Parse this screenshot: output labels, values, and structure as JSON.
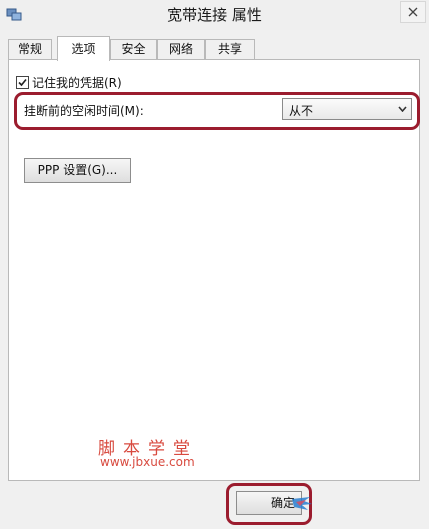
{
  "window": {
    "title": "宽带连接 属性"
  },
  "tabs": [
    {
      "label": "常规",
      "active": false
    },
    {
      "label": "选项",
      "active": true
    },
    {
      "label": "安全",
      "active": false
    },
    {
      "label": "网络",
      "active": false
    },
    {
      "label": "共享",
      "active": false
    }
  ],
  "options": {
    "remember_credentials": {
      "label": "记住我的凭据(R)",
      "checked": true
    },
    "idle_hangup": {
      "label": "挂断前的空闲时间(M):",
      "selected": "从不"
    },
    "ppp_button_label": "PPP 设置(G)..."
  },
  "watermark": {
    "name": "脚本学堂",
    "url": "www.jbxue.com"
  },
  "footer": {
    "ok_label": "确定"
  },
  "colors": {
    "highlight": "#9b1c2e",
    "watermark": "#d84a3f",
    "panel": "#ffffff",
    "window": "#f0f0f0"
  }
}
